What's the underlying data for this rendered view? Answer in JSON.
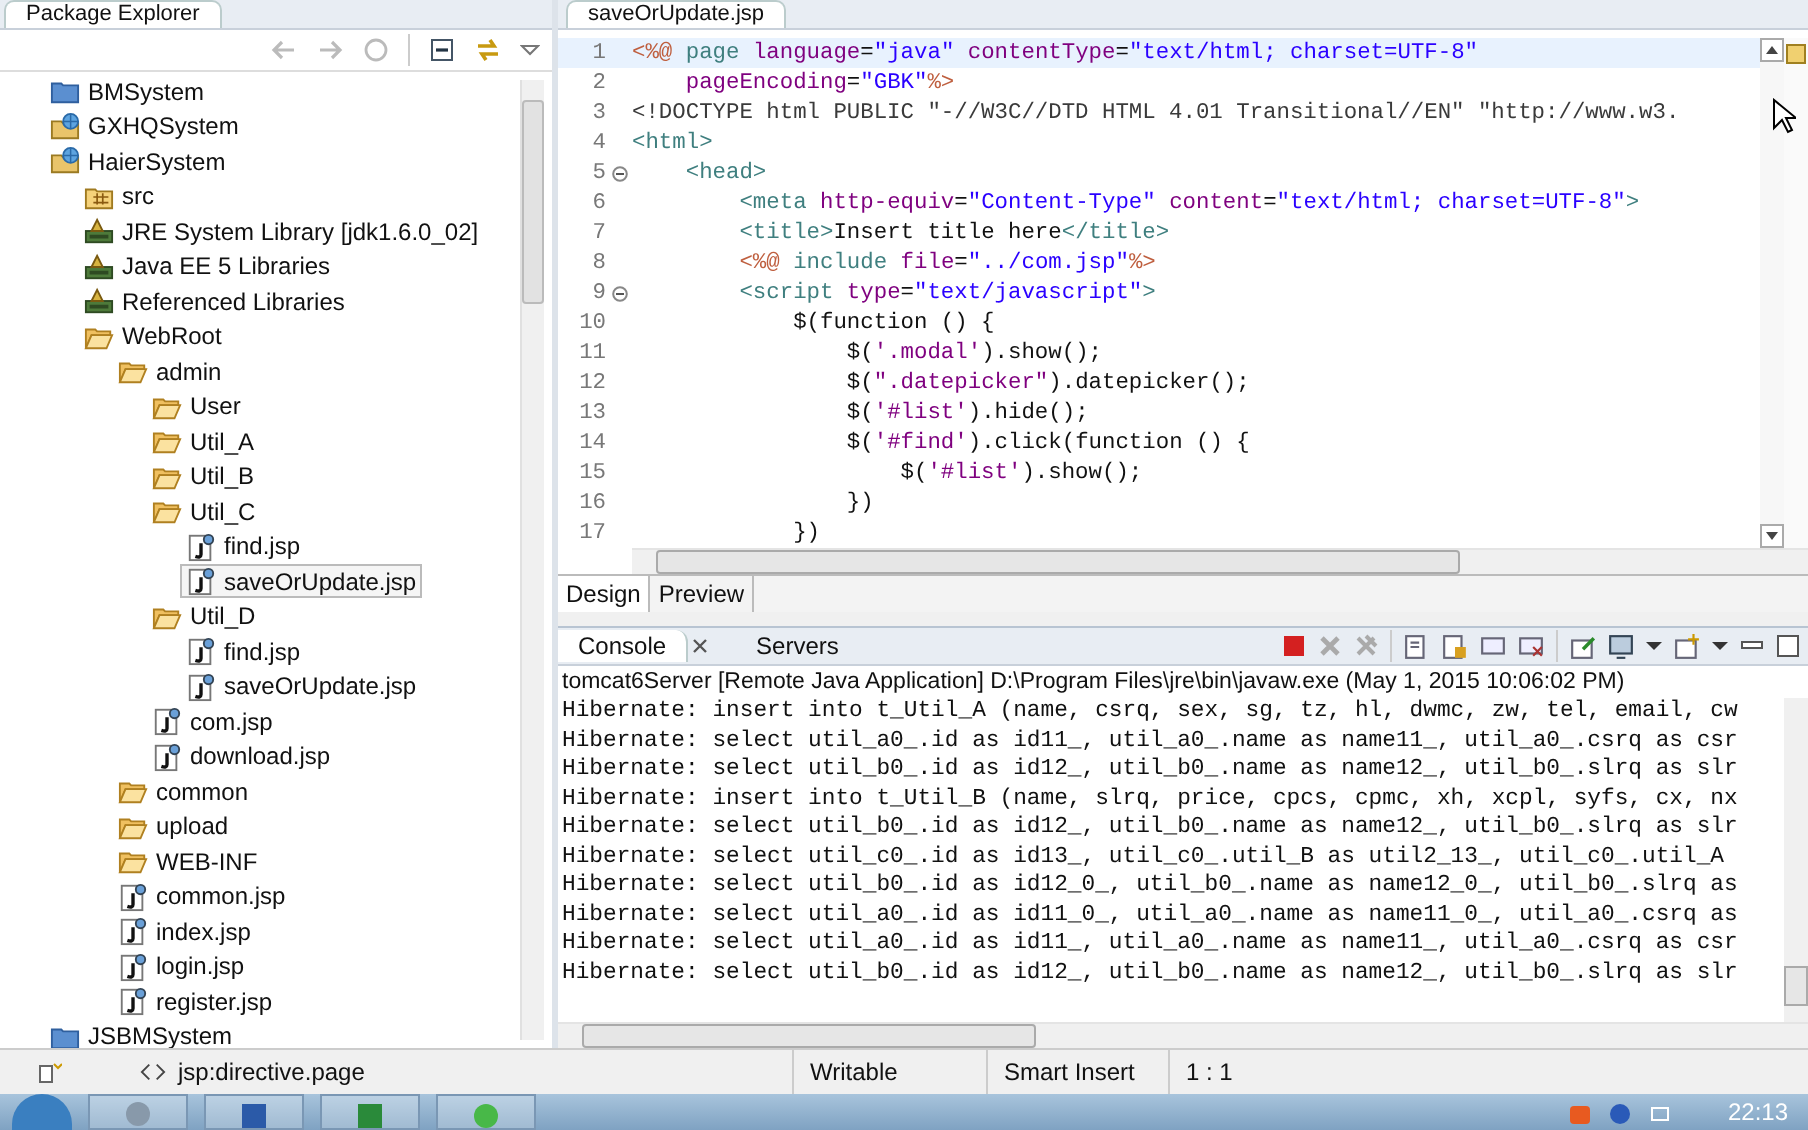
{
  "explorer": {
    "title": "Package Explorer",
    "tree": [
      {
        "label": "BMSystem",
        "kind": "project",
        "selected": false
      },
      {
        "label": "GXHQSystem",
        "kind": "web-project",
        "selected": false
      },
      {
        "label": "HaierSystem",
        "kind": "web-project",
        "selected": false,
        "children": [
          {
            "label": "src",
            "kind": "source-folder",
            "selected": false
          },
          {
            "label": "JRE System Library [jdk1.6.0_02]",
            "kind": "library",
            "selected": false
          },
          {
            "label": "Java EE 5 Libraries",
            "kind": "library",
            "selected": false
          },
          {
            "label": "Referenced Libraries",
            "kind": "library",
            "selected": false
          },
          {
            "label": "WebRoot",
            "kind": "folder",
            "selected": false,
            "children": [
              {
                "label": "admin",
                "kind": "folder",
                "selected": false,
                "children": [
                  {
                    "label": "User",
                    "kind": "folder",
                    "selected": false
                  },
                  {
                    "label": "Util_A",
                    "kind": "folder",
                    "selected": false
                  },
                  {
                    "label": "Util_B",
                    "kind": "folder",
                    "selected": false
                  },
                  {
                    "label": "Util_C",
                    "kind": "folder",
                    "selected": false,
                    "children": [
                      {
                        "label": "find.jsp",
                        "kind": "jsp",
                        "selected": false
                      },
                      {
                        "label": "saveOrUpdate.jsp",
                        "kind": "jsp",
                        "selected": true
                      }
                    ]
                  },
                  {
                    "label": "Util_D",
                    "kind": "folder",
                    "selected": false,
                    "children": [
                      {
                        "label": "find.jsp",
                        "kind": "jsp",
                        "selected": false
                      },
                      {
                        "label": "saveOrUpdate.jsp",
                        "kind": "jsp",
                        "selected": false
                      }
                    ]
                  },
                  {
                    "label": "com.jsp",
                    "kind": "jsp",
                    "selected": false
                  },
                  {
                    "label": "download.jsp",
                    "kind": "jsp",
                    "selected": false
                  }
                ]
              },
              {
                "label": "common",
                "kind": "folder",
                "selected": false
              },
              {
                "label": "upload",
                "kind": "folder",
                "selected": false
              },
              {
                "label": "WEB-INF",
                "kind": "folder",
                "selected": false
              },
              {
                "label": "common.jsp",
                "kind": "jsp",
                "selected": false
              },
              {
                "label": "index.jsp",
                "kind": "jsp",
                "selected": false
              },
              {
                "label": "login.jsp",
                "kind": "jsp",
                "selected": false
              },
              {
                "label": "register.jsp",
                "kind": "jsp",
                "selected": false
              }
            ]
          }
        ]
      },
      {
        "label": "JSBMSystem",
        "kind": "project",
        "selected": false
      }
    ]
  },
  "editor": {
    "tab": "saveOrUpdate.jsp",
    "lines": [
      {
        "number": "1",
        "current": true,
        "foldable": false,
        "segments": [
          {
            "kind": "jsp",
            "text": "<%@ "
          },
          {
            "kind": "tag",
            "text": "page "
          },
          {
            "kind": "attr",
            "text": "language"
          },
          {
            "kind": "text",
            "text": "="
          },
          {
            "kind": "value",
            "text": "\"java\" "
          },
          {
            "kind": "attr",
            "text": "contentType"
          },
          {
            "kind": "text",
            "text": "="
          },
          {
            "kind": "value",
            "text": "\"text/html; charset=UTF-8\""
          }
        ]
      },
      {
        "number": "2",
        "current": false,
        "foldable": false,
        "segments": [
          {
            "kind": "attr",
            "text": "    pageEncoding"
          },
          {
            "kind": "text",
            "text": "="
          },
          {
            "kind": "value",
            "text": "\"GBK\""
          },
          {
            "kind": "jsp",
            "text": "%>"
          }
        ]
      },
      {
        "number": "3",
        "current": false,
        "foldable": false,
        "segments": [
          {
            "kind": "doctype",
            "text": "<!DOCTYPE html PUBLIC \"-//W3C//DTD HTML 4.01 Transitional//EN\" \"http://www.w3."
          }
        ]
      },
      {
        "number": "4",
        "current": false,
        "foldable": false,
        "segments": [
          {
            "kind": "tag",
            "text": "<html>"
          }
        ]
      },
      {
        "number": "5",
        "current": false,
        "foldable": true,
        "segments": [
          {
            "kind": "tag",
            "text": "    <head>"
          }
        ]
      },
      {
        "number": "6",
        "current": false,
        "foldable": false,
        "segments": [
          {
            "kind": "tag",
            "text": "        <meta "
          },
          {
            "kind": "attr",
            "text": "http-equiv"
          },
          {
            "kind": "text",
            "text": "="
          },
          {
            "kind": "value",
            "text": "\"Content-Type\" "
          },
          {
            "kind": "attr",
            "text": "content"
          },
          {
            "kind": "text",
            "text": "="
          },
          {
            "kind": "value",
            "text": "\"text/html; charset=UTF-8\""
          },
          {
            "kind": "tag",
            "text": ">"
          }
        ]
      },
      {
        "number": "7",
        "current": false,
        "foldable": false,
        "segments": [
          {
            "kind": "tag",
            "text": "        <title>"
          },
          {
            "kind": "text",
            "text": "Insert title here"
          },
          {
            "kind": "tag",
            "text": "</title>"
          }
        ]
      },
      {
        "number": "8",
        "current": false,
        "foldable": false,
        "segments": [
          {
            "kind": "jsp",
            "text": "        <%@ "
          },
          {
            "kind": "tag",
            "text": "include "
          },
          {
            "kind": "attr",
            "text": "file"
          },
          {
            "kind": "text",
            "text": "="
          },
          {
            "kind": "value",
            "text": "\"../com.jsp\""
          },
          {
            "kind": "jsp",
            "text": "%>"
          }
        ]
      },
      {
        "number": "9",
        "current": false,
        "foldable": true,
        "segments": [
          {
            "kind": "tag",
            "text": "        <script "
          },
          {
            "kind": "attr",
            "text": "type"
          },
          {
            "kind": "text",
            "text": "="
          },
          {
            "kind": "value",
            "text": "\"text/javascript\""
          },
          {
            "kind": "tag",
            "text": ">"
          }
        ]
      },
      {
        "number": "10",
        "current": false,
        "foldable": false,
        "segments": [
          {
            "kind": "text",
            "text": "            $(function () {"
          }
        ]
      },
      {
        "number": "11",
        "current": false,
        "foldable": false,
        "segments": [
          {
            "kind": "text",
            "text": "                $("
          },
          {
            "kind": "jsstring",
            "text": "'.modal'"
          },
          {
            "kind": "text",
            "text": ").show();"
          }
        ]
      },
      {
        "number": "12",
        "current": false,
        "foldable": false,
        "segments": [
          {
            "kind": "text",
            "text": "                $("
          },
          {
            "kind": "jsstring",
            "text": "\".datepicker\""
          },
          {
            "kind": "text",
            "text": ").datepicker();"
          }
        ]
      },
      {
        "number": "13",
        "current": false,
        "foldable": false,
        "segments": [
          {
            "kind": "text",
            "text": "                $("
          },
          {
            "kind": "jsstring",
            "text": "'#list'"
          },
          {
            "kind": "text",
            "text": ").hide();"
          }
        ]
      },
      {
        "number": "14",
        "current": false,
        "foldable": false,
        "segments": [
          {
            "kind": "text",
            "text": "                $("
          },
          {
            "kind": "jsstring",
            "text": "'#find'"
          },
          {
            "kind": "text",
            "text": ").click(function () {"
          }
        ]
      },
      {
        "number": "15",
        "current": false,
        "foldable": false,
        "segments": [
          {
            "kind": "text",
            "text": "                    $("
          },
          {
            "kind": "jsstring",
            "text": "'#list'"
          },
          {
            "kind": "text",
            "text": ").show();"
          }
        ]
      },
      {
        "number": "16",
        "current": false,
        "foldable": false,
        "segments": [
          {
            "kind": "text",
            "text": "                })"
          }
        ]
      },
      {
        "number": "17",
        "current": false,
        "foldable": false,
        "segments": [
          {
            "kind": "text",
            "text": "            })"
          }
        ]
      }
    ],
    "view_tabs": [
      {
        "label": "Design",
        "selected": true
      },
      {
        "label": "Preview",
        "selected": false
      }
    ]
  },
  "console": {
    "tabs": [
      {
        "label": "Console",
        "selected": true,
        "closable": true
      },
      {
        "label": "Servers",
        "selected": false,
        "closable": false
      }
    ],
    "header": "tomcat6Server [Remote Java Application] D:\\Program Files\\jre\\bin\\javaw.exe (May 1, 2015 10:06:02 PM)",
    "lines": [
      "Hibernate: insert into t_Util_A (name, csrq, sex, sg, tz, hl, dwmc, zw, tel, email, cw",
      "Hibernate: select util_a0_.id as id11_, util_a0_.name as name11_, util_a0_.csrq as csr",
      "Hibernate: select util_b0_.id as id12_, util_b0_.name as name12_, util_b0_.slrq as slr",
      "Hibernate: insert into t_Util_B (name, slrq, price, cpcs, cpmc, xh, xcpl, syfs, cx, nx",
      "Hibernate: select util_b0_.id as id12_, util_b0_.name as name12_, util_b0_.slrq as slr",
      "Hibernate: select util_c0_.id as id13_, util_c0_.util_B as util2_13_, util_c0_.util_A",
      "Hibernate: select util_b0_.id as id12_0_, util_b0_.name as name12_0_, util_b0_.slrq as",
      "Hibernate: select util_a0_.id as id11_0_, util_a0_.name as name11_0_, util_a0_.csrq as",
      "Hibernate: select util_a0_.id as id11_, util_a0_.name as name11_, util_a0_.csrq as csr",
      "Hibernate: select util_b0_.id as id12_, util_b0_.name as name12_, util_b0_.slrq as slr"
    ]
  },
  "status_bar": {
    "element": "jsp:directive.page",
    "mode": "Writable",
    "insert_mode": "Smart Insert",
    "position": "1 : 1"
  },
  "taskbar": {
    "clock": "22:13"
  }
}
